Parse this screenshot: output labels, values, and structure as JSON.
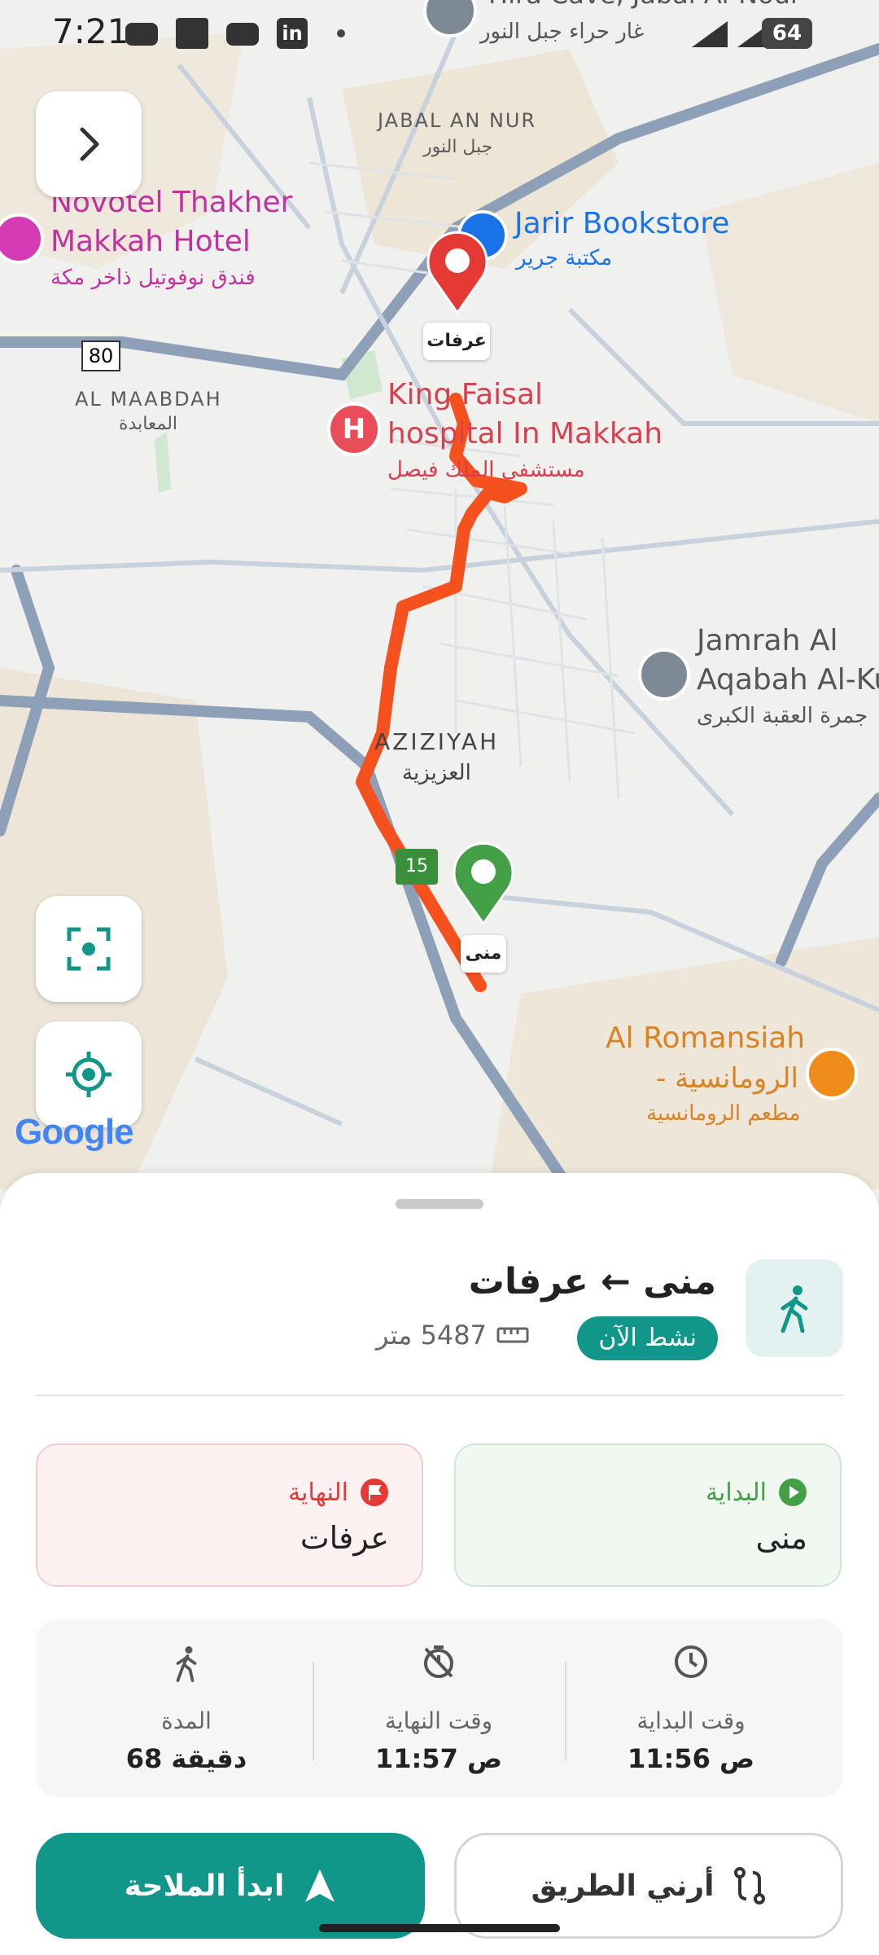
{
  "status_bar": {
    "time": "7:21",
    "battery": "64",
    "icons": [
      "youtube-icon",
      "square-icon",
      "youtube-icon",
      "linkedin-icon",
      "dot-icon"
    ]
  },
  "map": {
    "labels": {
      "hira_cave": "Hira Cave, Jabal Al-Nour",
      "hira_cave_ar": "غار حراء جبل النور",
      "jabal_an_nur": "JABAL AN NUR",
      "jabal_an_nur_ar": "جبل النور",
      "novotel": "Novotel Thakher",
      "novotel_2": "Makkah Hotel",
      "novotel_ar": "فندق نوفوتيل ذاخر مكة",
      "jarir": "Jarir Bookstore",
      "jarir_ar": "مكتبة جرير",
      "road_80": "80",
      "al_maabdah": "AL MAABDAH",
      "al_maabdah_ar": "المعابدة",
      "king_faisal": "King Faisal",
      "king_faisal_2": "hospital In Makkah",
      "king_faisal_ar": "مستشفى الملك فيصل",
      "jamrah": "Jamrah Al",
      "jamrah_2": "Aqabah Al-Ku",
      "jamrah_ar": "جمرة العقبة الكبرى",
      "aziziyah": "AZIZIYAH",
      "aziziyah_ar": "العزيزية",
      "road_15": "15",
      "romansiah": "Al Romansiah",
      "romansiah_2": "- الرومانسية",
      "romansiah_ar": "مطعم الرومانسية",
      "google": "Google"
    },
    "end_pin_label": "عرفات",
    "start_pin_label": "منى",
    "colors": {
      "route": "#f4511e",
      "start_pin": "#43a047",
      "end_pin": "#e53935",
      "poi_red": "#ea4d5a",
      "poi_blue": "#1a73e8",
      "poi_orange": "#f08c1a",
      "hotel": "#d63bb5"
    }
  },
  "sheet": {
    "route_title": "منى ← عرفات",
    "status_badge": "نشط الآن",
    "distance": "5487 متر",
    "start_card": {
      "label": "البداية",
      "value": "منى"
    },
    "end_card": {
      "label": "النهاية",
      "value": "عرفات"
    },
    "stats": {
      "start_time": {
        "label": "وقت البداية",
        "value": "11:56 ص"
      },
      "end_time": {
        "label": "وقت النهاية",
        "value": "11:57 ص"
      },
      "duration": {
        "label": "المدة",
        "value": "68 دقيقة"
      }
    },
    "buttons": {
      "show_route": "أرني الطريق",
      "start_navigation": "ابدأ الملاحة"
    },
    "accent": "#11968a"
  }
}
